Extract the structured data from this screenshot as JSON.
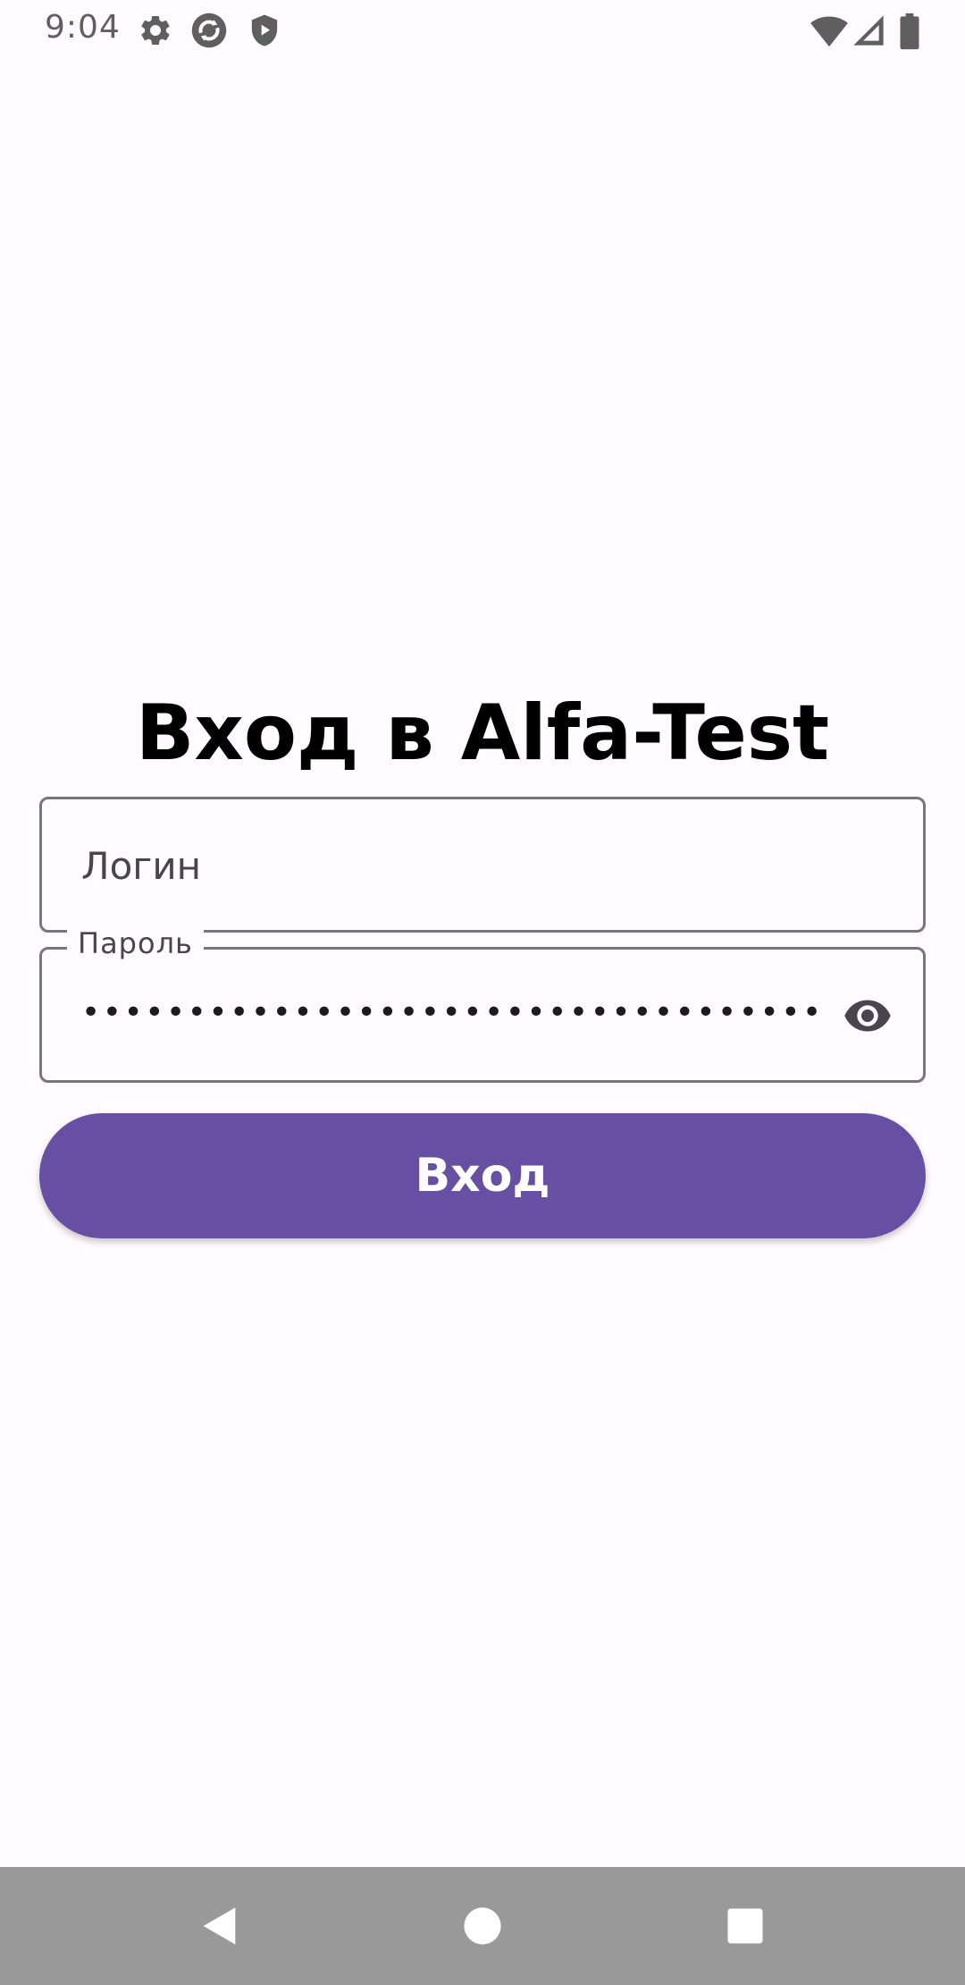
{
  "status_bar": {
    "time": "9:04",
    "icons": [
      "settings-icon",
      "sync-icon",
      "shield-play-icon",
      "wifi-icon",
      "signal-icon",
      "battery-icon"
    ]
  },
  "login_screen": {
    "title": "Вход в Alfa-Test",
    "login_field": {
      "placeholder": "Логин",
      "value": ""
    },
    "password_field": {
      "label": "Пароль",
      "masked_value": "•••••••••••••••••••••••••••••••••••••••••••••••••••••••••••••••••••••••••••••••••••••••",
      "visibility_icon": "eye-icon"
    },
    "submit_label": "Вход"
  },
  "nav_bar": {
    "buttons": [
      "back-icon",
      "home-icon",
      "recents-icon"
    ]
  },
  "colors": {
    "background": "#fffbfe",
    "primary": "#6750a4",
    "outline": "#79747e",
    "nav_bar": "#999999"
  }
}
